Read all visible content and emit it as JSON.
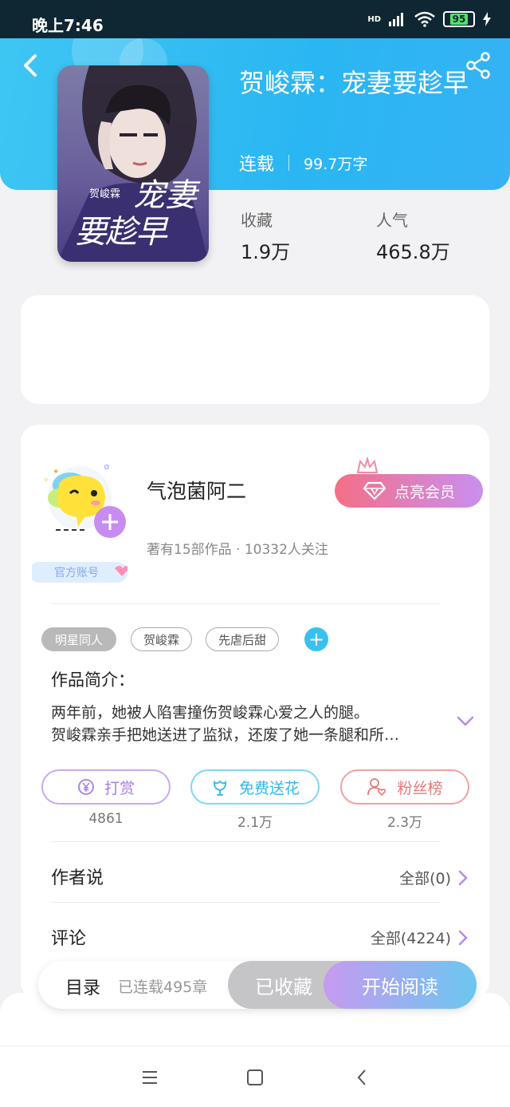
{
  "status_bar": {
    "time": "晚上7:46",
    "network": "HD",
    "battery": "95"
  },
  "book": {
    "title": "贺峻霖：宠妻要趁早",
    "status": "连载",
    "word_count": "99.7万字",
    "stats": [
      {
        "label": "收藏",
        "value": "1.9万"
      },
      {
        "label": "人气",
        "value": "465.8万"
      }
    ],
    "cover_text": {
      "name": "贺峻霖",
      "line1": "宠妻",
      "line2": "要趁早"
    }
  },
  "author": {
    "name": "气泡菌阿二",
    "meta": "著有15部作品 · 10332人关注",
    "official_badge": "官方账号",
    "vip_label": "点亮会员"
  },
  "tags": [
    "明星同人",
    "贺峻霖",
    "先虐后甜"
  ],
  "intro": {
    "title": "作品简介：",
    "line1": "两年前，她被人陷害撞伤贺峻霖心爱之人的腿。",
    "line2": "贺峻霖亲手把她送进了监狱，还废了她一条腿和所…"
  },
  "actions": [
    {
      "label": "打赏",
      "count": "4861",
      "color": "#b38be8"
    },
    {
      "label": "免费送花",
      "count": "2.1万",
      "color": "#38c1ef"
    },
    {
      "label": "粉丝榜",
      "count": "2.3万",
      "color": "#ef7b7b"
    }
  ],
  "author_says": {
    "title": "作者说",
    "link": "全部(0)"
  },
  "comments": {
    "title": "评论",
    "link": "全部(4224)"
  },
  "bottom_bar": {
    "toc_label": "目录",
    "toc_sub": "已连载495章",
    "collected": "已收藏",
    "start_reading": "开始阅读"
  },
  "colors": {
    "header_blue": "#2ab6f2",
    "accent_cyan": "#38c1ef"
  },
  "icons": {
    "back": "back-icon",
    "share": "share-icon",
    "diamond": "diamond-icon",
    "crown": "crown-icon",
    "expand": "chevron-down-icon",
    "chevron": "chevron-right-icon"
  }
}
